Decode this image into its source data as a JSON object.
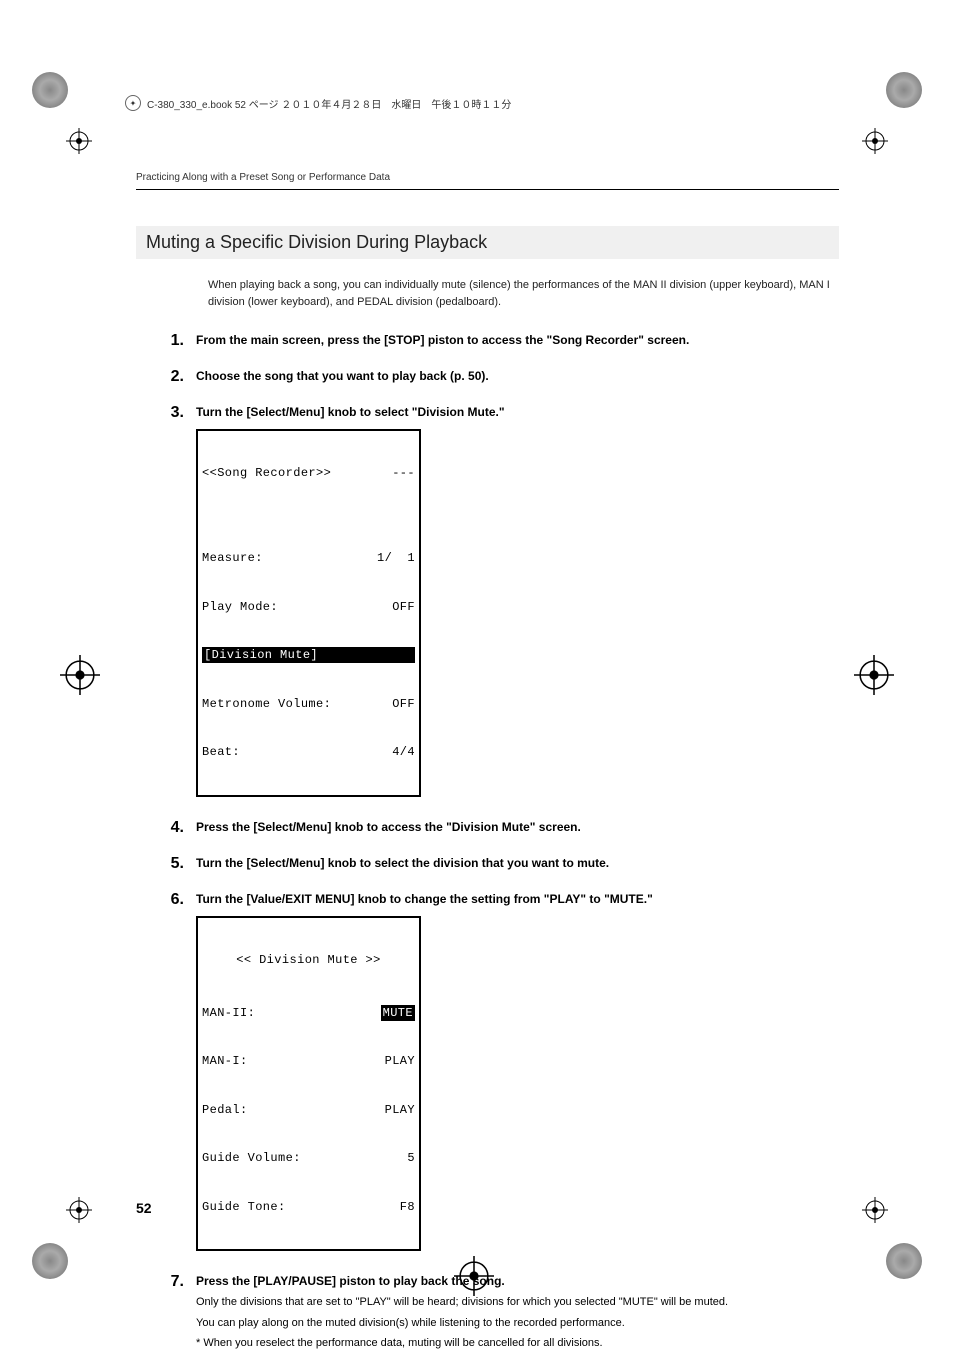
{
  "meta": {
    "file_info": "C-380_330_e.book  52 ページ  ２０１０年４月２８日　水曜日　午後１０時１１分"
  },
  "running_header": "Practicing Along with a Preset Song or Performance Data",
  "section_title": "Muting a Specific Division During Playback",
  "intro": "When playing back a song, you can individually mute (silence) the performances of the MAN II division (upper keyboard), MAN I division (lower keyboard), and PEDAL division (pedalboard).",
  "steps": {
    "s1": {
      "num": "1.",
      "title": "From the main screen, press the [STOP] piston to access the \"Song Recorder\" screen."
    },
    "s2": {
      "num": "2.",
      "title": "Choose the song that you want to play back (p. 50)."
    },
    "s3": {
      "num": "3.",
      "title": "Turn the [Select/Menu] knob to select \"Division Mute.\""
    },
    "s4": {
      "num": "4.",
      "title": "Press the [Select/Menu] knob to access the \"Division Mute\" screen."
    },
    "s5": {
      "num": "5.",
      "title": "Turn the [Select/Menu] knob to select the division that you want to mute."
    },
    "s6": {
      "num": "6.",
      "title": "Turn the [Value/EXIT MENU] knob to change the setting from \"PLAY\" to \"MUTE.\""
    },
    "s7": {
      "num": "7.",
      "title": "Press the [PLAY/PAUSE] piston to play back the song.",
      "desc1": "Only the divisions that are set to \"PLAY\" will be heard; divisions for which you selected \"MUTE\" will be muted.",
      "desc2": "You can play along on the muted division(s) while listening to the recorded performance.",
      "note": "*   When you reselect the performance data, muting will be cancelled for all divisions."
    }
  },
  "lcd1": {
    "title_left": "<<Song Recorder>>",
    "title_right": "---",
    "r1_label": "Measure:",
    "r1_val": "1/  1",
    "r2_label": "Play Mode:",
    "r2_val": "OFF",
    "r3": "[Division Mute]",
    "r4_label": "Metronome Volume:",
    "r4_val": "OFF",
    "r5_label": "Beat:",
    "r5_val": "4/4"
  },
  "lcd2": {
    "title": "<< Division Mute >>",
    "r1_label": "MAN-II:",
    "r1_val": "MUTE",
    "r2_label": "MAN-I:",
    "r2_val": "PLAY",
    "r3_label": "Pedal:",
    "r3_val": "PLAY",
    "r4_label": "Guide Volume:",
    "r4_val": "5",
    "r5_label": "Guide Tone:",
    "r5_val": "F8"
  },
  "page_number": "52"
}
